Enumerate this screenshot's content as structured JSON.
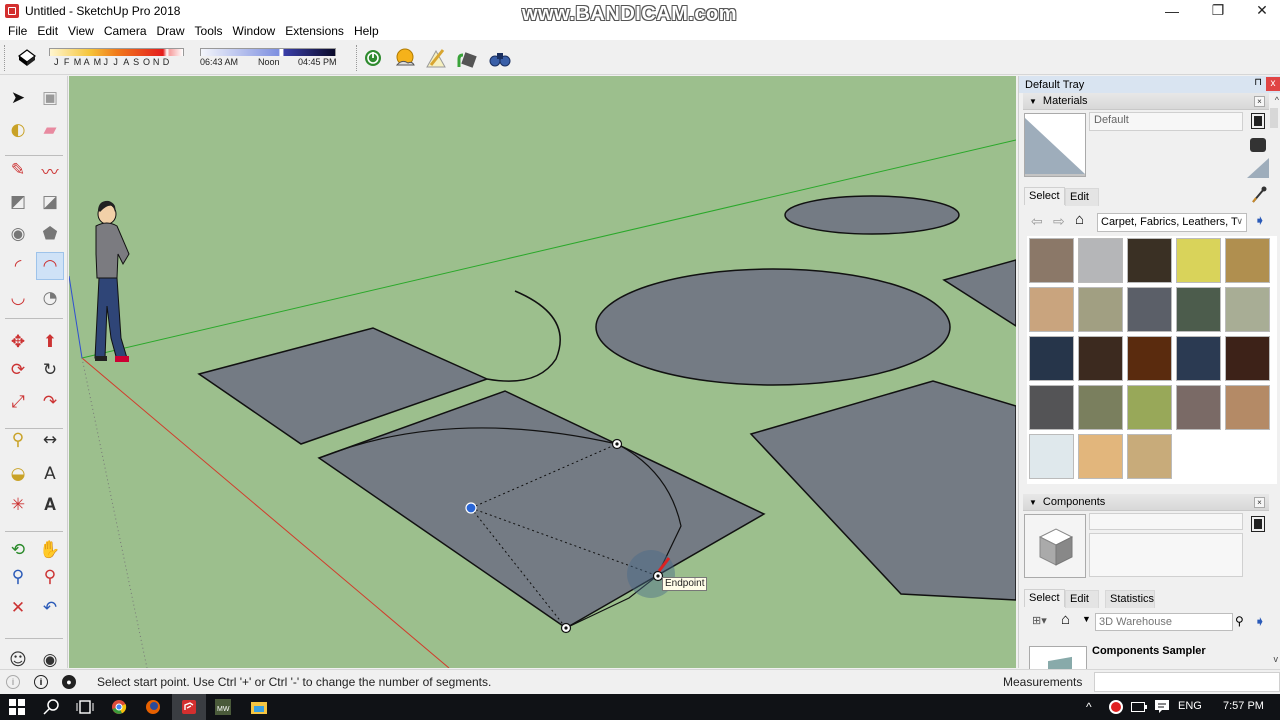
{
  "window": {
    "title": "Untitled - SketchUp Pro 2018",
    "watermark": "www.BANDICAM.com",
    "controls": {
      "minimize": "—",
      "maximize": "❐",
      "close": "✕"
    }
  },
  "menu": [
    "File",
    "Edit",
    "View",
    "Camera",
    "Draw",
    "Tools",
    "Window",
    "Extensions",
    "Help"
  ],
  "shadow_toolbar": {
    "months": [
      "J",
      "F",
      "M",
      "A",
      "M",
      "J",
      "J",
      "A",
      "S",
      "O",
      "N",
      "D"
    ],
    "selected_month": "N",
    "time_start": "06:43 AM",
    "time_mid": "Noon",
    "time_end": "04:45 PM",
    "time_position_fraction": 0.6
  },
  "toolbar_icons": [
    "power-icon",
    "sun-weather-icon",
    "sandbox-pencil-icon",
    "paint-bucket-export-icon",
    "binoculars-icon"
  ],
  "tools": [
    "select",
    "make-component",
    "paint-bucket",
    "eraser",
    "line",
    "freehand",
    "rectangle",
    "rotated-rectangle",
    "circle",
    "polygon",
    "arc",
    "two-point-arc",
    "three-point-arc",
    "pie",
    "move",
    "push-pull",
    "rotate",
    "follow-me",
    "scale",
    "offset",
    "tape-measure",
    "dimension",
    "protractor",
    "text",
    "axes",
    "3d-text",
    "orbit",
    "pan",
    "zoom",
    "zoom-window",
    "zoom-extents",
    "previous-view",
    "position-camera",
    "look-around"
  ],
  "active_tool": "two-point-arc",
  "viewport": {
    "tooltip": "Endpoint",
    "colors": {
      "ground": "#9cbf8d",
      "face": "#747b84",
      "edge": "#111111",
      "red_axis": "#d23a2a",
      "green_axis": "#2aa82a",
      "blue_axis": "#3050d0",
      "inference_blue": "#2a66d6"
    }
  },
  "tray": {
    "title": "Default Tray",
    "pin": "⊓",
    "close": "x",
    "materials": {
      "header": "Materials",
      "name_value": "Default",
      "tabs": [
        "Select",
        "Edit"
      ],
      "active_tab": "Select",
      "collection": "Carpet, Fabrics, Leathers, T",
      "swatches": [
        {
          "name": "carpet-loop-brown",
          "color": "#8b7868"
        },
        {
          "name": "carpet-gray-pattern",
          "color": "#b5b6b8"
        },
        {
          "name": "carpet-diamond-dark",
          "color": "#3a3024"
        },
        {
          "name": "fabric-yellow-cross",
          "color": "#d9d35a"
        },
        {
          "name": "burlap-tan",
          "color": "#b08f4f"
        },
        {
          "name": "carpet-cross-pattern",
          "color": "#c9a47e"
        },
        {
          "name": "carpet-tile-sage",
          "color": "#a19f82"
        },
        {
          "name": "carpet-speckle-gray",
          "color": "#5b5f68"
        },
        {
          "name": "carpet-speckle-green",
          "color": "#4c5c4c"
        },
        {
          "name": "fabric-sage-light",
          "color": "#a8ad95"
        },
        {
          "name": "fabric-navy",
          "color": "#26354a"
        },
        {
          "name": "leather-dark-brown",
          "color": "#3c2a1f"
        },
        {
          "name": "leather-rust",
          "color": "#5a2b0e"
        },
        {
          "name": "fabric-denim",
          "color": "#2b3a52"
        },
        {
          "name": "leather-chocolate",
          "color": "#3d2218"
        },
        {
          "name": "fabric-charcoal",
          "color": "#545456"
        },
        {
          "name": "fabric-olive",
          "color": "#7a7f5e"
        },
        {
          "name": "fabric-green-floral",
          "color": "#98a859"
        },
        {
          "name": "carpet-multicolor",
          "color": "#7a6a66"
        },
        {
          "name": "fabric-striped",
          "color": "#b48a66"
        },
        {
          "name": "pattern-white-knot",
          "color": "#dfe8ec"
        },
        {
          "name": "fabric-tan-stripes",
          "color": "#e2b67c"
        },
        {
          "name": "fabric-wavy-tan",
          "color": "#c8ab7a"
        }
      ]
    },
    "components": {
      "header": "Components",
      "tabs": [
        "Select",
        "Edit",
        "Statistics"
      ],
      "active_tab": "Select",
      "search_placeholder": "3D Warehouse",
      "first_item": "Components Sampler"
    }
  },
  "statusbar": {
    "hint": "Select start point. Use Ctrl '+' or Ctrl '-' to change the number of segments.",
    "measurements_label": "Measurements",
    "measurements_value": ""
  },
  "taskbar": {
    "apps": [
      "start",
      "search",
      "task-view",
      "chrome",
      "firefox",
      "sketchup",
      "bandicam",
      "file-explorer"
    ],
    "active_app": "sketchup",
    "language": "ENG",
    "time": "7:57 PM"
  }
}
